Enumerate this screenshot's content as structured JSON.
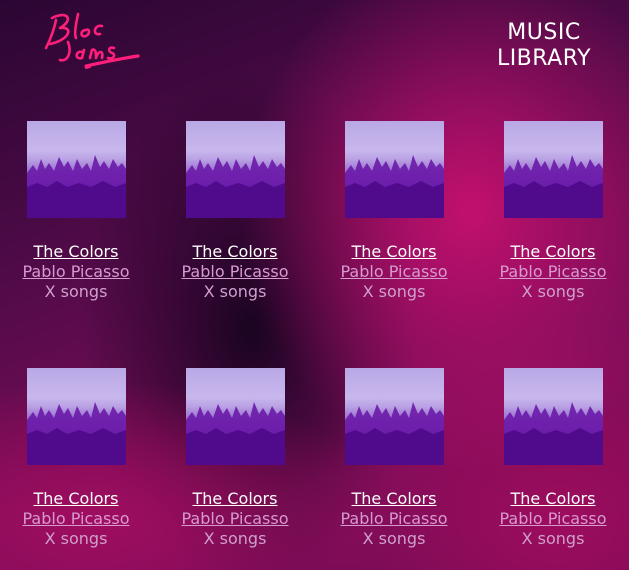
{
  "brand": {
    "logo_text": "Bloc Jams"
  },
  "header": {
    "title_line1": "MUSIC",
    "title_line2": "LIBRARY"
  },
  "albums": [
    {
      "title": "The Colors",
      "artist": "Pablo Picasso",
      "songs": "X songs"
    },
    {
      "title": "The Colors",
      "artist": "Pablo Picasso",
      "songs": "X songs"
    },
    {
      "title": "The Colors",
      "artist": "Pablo Picasso",
      "songs": "X songs"
    },
    {
      "title": "The Colors",
      "artist": "Pablo Picasso",
      "songs": "X songs"
    },
    {
      "title": "The Colors",
      "artist": "Pablo Picasso",
      "songs": "X songs"
    },
    {
      "title": "The Colors",
      "artist": "Pablo Picasso",
      "songs": "X songs"
    },
    {
      "title": "The Colors",
      "artist": "Pablo Picasso",
      "songs": "X songs"
    },
    {
      "title": "The Colors",
      "artist": "Pablo Picasso",
      "songs": "X songs"
    }
  ],
  "colors": {
    "logo": "#ff1f7a",
    "artist_link": "#d79ad0",
    "title_link": "#ffffff"
  }
}
